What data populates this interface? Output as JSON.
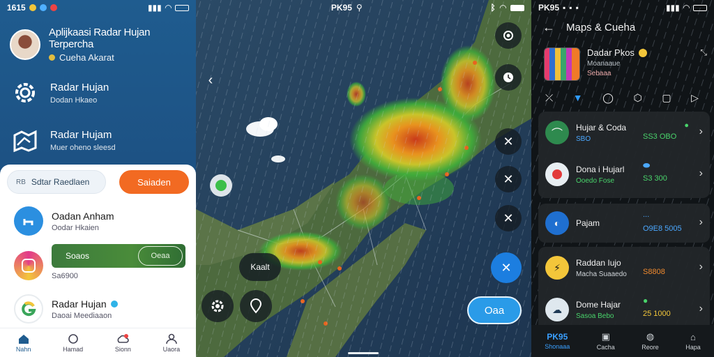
{
  "left": {
    "status": {
      "time": "1615"
    },
    "header": {
      "title": "Aplijkaasi Radar Hujan Terpercha",
      "subtitle": "Cueha Akarat"
    },
    "menu": [
      {
        "title": "Radar Hujan",
        "subtitle": "Dodan Hkaeo"
      },
      {
        "title": "Radar Hujam",
        "subtitle": "Muer oheno sleesd"
      }
    ],
    "sheet": {
      "search_label": "Sdtar Raedlaen",
      "search_prefix": "RB",
      "orange_button": "Saiaden",
      "row1": {
        "title": "Oadan Anham",
        "subtitle": "Oodar Hkaien"
      },
      "progress": {
        "label": "Soaos",
        "button": "Oeaa",
        "sub": "Sa6900"
      },
      "row3": {
        "title": "Radar Hujan",
        "subtitle": "Daoai Meediaaon"
      }
    },
    "nav": [
      "Nahn",
      "Hamad",
      "Sionn",
      "Uaora"
    ]
  },
  "center": {
    "status": {
      "title": "PK95"
    },
    "location_label": "Kaalt",
    "cta": "Oaa"
  },
  "right": {
    "status": {
      "time": "PK95"
    },
    "topbar": {
      "title": "Maps & Cueha"
    },
    "card": {
      "title": "Dadar Pkos",
      "subtitle": "Moanaaue",
      "subtitle2": "Sebaaa"
    },
    "list1": [
      {
        "title": "Hujar & Coda",
        "sub": "SBO",
        "mid": "SS3 OBO",
        "mid_top": ""
      },
      {
        "title": "Dona i Hujarl",
        "sub": "Ooedo Fose",
        "mid": "S3 300",
        "mid_top": ""
      }
    ],
    "list2": [
      {
        "title": "Pajam",
        "sub": "",
        "mid": "O9E8 5005",
        "mid_top": "..."
      }
    ],
    "list3": [
      {
        "title": "Raddan Iujo",
        "sub": "Macha Suaaedo",
        "mid": "S8808",
        "mid_top": ""
      },
      {
        "title": "Dome Hajar",
        "sub": "Sasoa Bebo",
        "mid": "25 1000",
        "mid_top": ""
      }
    ],
    "nav": [
      "Shonaaa",
      "Cacha",
      "Reore",
      "Hapa"
    ],
    "nav_active": "PK95"
  }
}
